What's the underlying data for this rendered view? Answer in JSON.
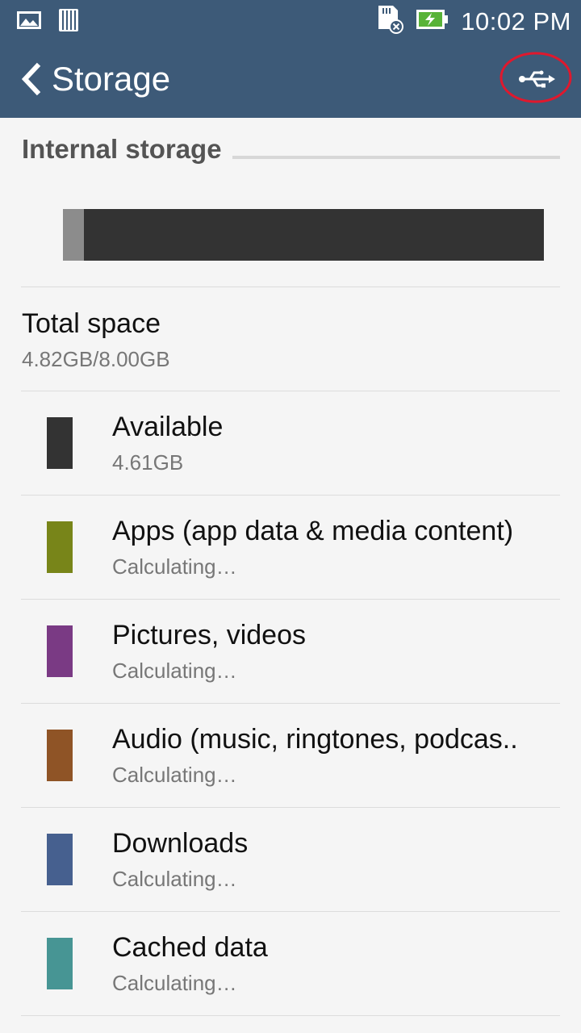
{
  "status_bar": {
    "time": "10:02 PM",
    "icons": [
      "gallery-icon",
      "barcode-icon",
      "sd-card-error-icon",
      "battery-charging-icon"
    ]
  },
  "app_bar": {
    "title": "Storage",
    "back_icon": "chevron-left-icon",
    "action_icon": "usb-icon",
    "color": "#3d5a78",
    "highlight_color": "#e0182d"
  },
  "internal_storage": {
    "header": "Internal storage",
    "usage_bar": [
      {
        "name": "used",
        "fraction": 0.043,
        "color": "#8c8c8c"
      },
      {
        "name": "Available",
        "fraction": 0.957,
        "color": "#333333"
      }
    ],
    "total": {
      "label": "Total space",
      "value": "4.82GB/8.00GB"
    },
    "categories": [
      {
        "label": "Available",
        "value": "4.61GB",
        "color": "#333333"
      },
      {
        "label": "Apps (app data & media content)",
        "value": "Calculating…",
        "color": "#788519"
      },
      {
        "label": "Pictures, videos",
        "value": "Calculating…",
        "color": "#7a3a84"
      },
      {
        "label": "Audio (music, ringtones, podcas..",
        "value": "Calculating…",
        "color": "#8f5426"
      },
      {
        "label": "Downloads",
        "value": "Calculating…",
        "color": "#46608f"
      },
      {
        "label": "Cached data",
        "value": "Calculating…",
        "color": "#479594"
      }
    ]
  }
}
